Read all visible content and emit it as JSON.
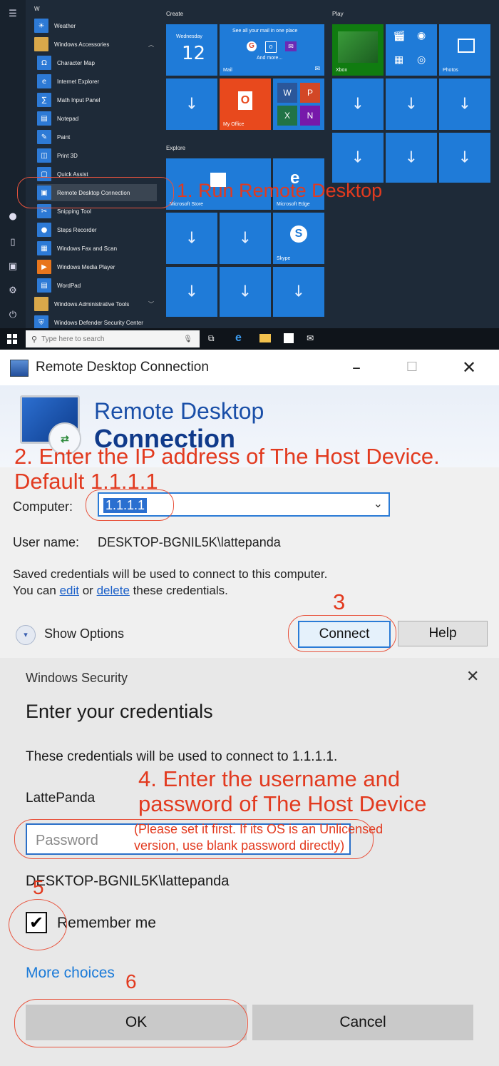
{
  "start_menu": {
    "section_letter": "W",
    "apps": [
      {
        "label": "Weather",
        "icon": "weather-icon"
      },
      {
        "label": "Windows Accessories",
        "icon": "folder-icon"
      },
      {
        "label": "Character Map",
        "icon": "character-map-icon"
      },
      {
        "label": "Internet Explorer",
        "icon": "internet-explorer-icon"
      },
      {
        "label": "Math Input Panel",
        "icon": "math-input-icon"
      },
      {
        "label": "Notepad",
        "icon": "notepad-icon"
      },
      {
        "label": "Paint",
        "icon": "paint-icon"
      },
      {
        "label": "Print 3D",
        "icon": "print3d-icon"
      },
      {
        "label": "Quick Assist",
        "icon": "quick-assist-icon"
      },
      {
        "label": "Remote Desktop Connection",
        "icon": "remote-desktop-icon"
      },
      {
        "label": "Snipping Tool",
        "icon": "snipping-tool-icon"
      },
      {
        "label": "Steps Recorder",
        "icon": "steps-recorder-icon"
      },
      {
        "label": "Windows Fax and Scan",
        "icon": "fax-scan-icon"
      },
      {
        "label": "Windows Media Player",
        "icon": "media-player-icon"
      },
      {
        "label": "WordPad",
        "icon": "wordpad-icon"
      },
      {
        "label": "Windows Administrative Tools",
        "icon": "folder-icon"
      },
      {
        "label": "Windows Defender Security Center",
        "icon": "shield-icon"
      }
    ],
    "groups": {
      "create": "Create",
      "play": "Play",
      "explore": "Explore"
    },
    "tiles": {
      "calendar_day": "Wednesday",
      "calendar_date": "12",
      "mail_header": "See all your mail in one place",
      "mail_more": "And more...",
      "mail": "Mail",
      "my_office": "My Office",
      "xbox": "Xbox",
      "photos": "Photos",
      "store": "Microsoft Store",
      "edge": "Microsoft Edge",
      "skype": "Skype"
    }
  },
  "taskbar": {
    "search_placeholder": "Type here to search"
  },
  "rdc": {
    "window_title": "Remote Desktop Connection",
    "banner_line1": "Remote Desktop",
    "banner_line2": "Connection",
    "computer_label": "Computer:",
    "computer_value": "1.1.1.1",
    "username_label": "User name:",
    "username_value": "DESKTOP-BGNIL5K\\lattepanda",
    "saved_line1": "Saved credentials will be used to connect to this computer.",
    "you_can": "You can",
    "edit": "edit",
    "or": "or",
    "delete": "delete",
    "these_credentials": "these credentials.",
    "show_options": "Show Options",
    "connect": "Connect",
    "help": "Help"
  },
  "security": {
    "title": "Windows Security",
    "heading": "Enter your credentials",
    "description": "These credentials will be used to connect to 1.1.1.1.",
    "username": "LattePanda",
    "password_placeholder": "Password",
    "domain": "DESKTOP-BGNIL5K\\lattepanda",
    "remember_me": "Remember me",
    "more_choices": "More choices",
    "ok": "OK",
    "cancel": "Cancel"
  },
  "annotations": {
    "step1": "1. Run Remote Desktop",
    "step2_line1": "2. Enter the IP address of The Host Device.",
    "step2_line2": "Default 1.1.1.1",
    "step3": "3",
    "step4_line1": "4. Enter the username and",
    "step4_line2": "password of The Host Device",
    "step4_note_line1": "(Please set it first.  If its OS is an Unlicensed",
    "step4_note_line2": "version, use blank password directly)",
    "step5": "5",
    "step6": "6"
  },
  "colors": {
    "tile_blue": "#1f7bd8",
    "office_orange": "#e8491d",
    "annotation_red": "#e23a1f",
    "link_blue": "#1a5fc8"
  }
}
